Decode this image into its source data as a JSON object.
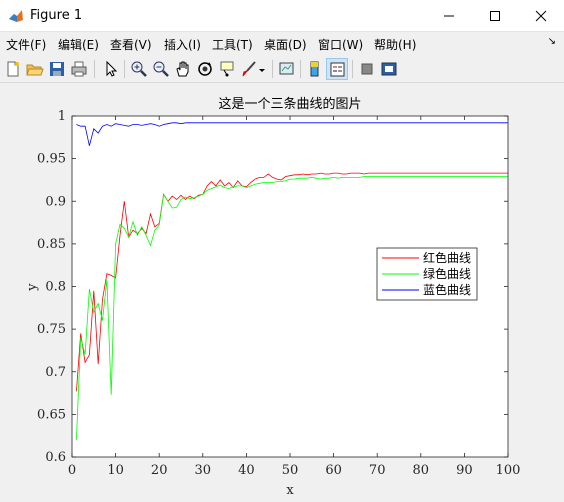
{
  "window": {
    "title": "Figure 1",
    "controls": [
      "minimize",
      "maximize",
      "close"
    ]
  },
  "menu": {
    "items": [
      "文件(F)",
      "编辑(E)",
      "查看(V)",
      "插入(I)",
      "工具(T)",
      "桌面(D)",
      "窗口(W)",
      "帮助(H)"
    ]
  },
  "toolbar": {
    "buttons": [
      "new-figure-icon",
      "open-file-icon",
      "save-icon",
      "print-icon",
      "select-arrow-icon",
      "zoom-in-icon",
      "zoom-out-icon",
      "pan-hand-icon",
      "rotate-3d-icon",
      "data-cursor-icon",
      "brush-icon",
      "link-plot-icon",
      "colorbar-icon",
      "legend-icon",
      "hide-plot-tools-icon",
      "show-plot-tools-icon"
    ]
  },
  "chart_data": {
    "type": "line",
    "title": "这是一个三条曲线的图片",
    "xlabel": "x",
    "ylabel": "y",
    "xlim": [
      0,
      100
    ],
    "ylim": [
      0.6,
      1.0
    ],
    "xticks": [
      0,
      10,
      20,
      30,
      40,
      50,
      60,
      70,
      80,
      90,
      100
    ],
    "yticks": [
      0.6,
      0.65,
      0.7,
      0.75,
      0.8,
      0.85,
      0.9,
      0.95,
      1.0
    ],
    "ytick_labels": [
      "0.6",
      "0.65",
      "0.7",
      "0.75",
      "0.8",
      "0.85",
      "0.9",
      "0.95",
      "1"
    ],
    "grid": false,
    "legend_position": "right",
    "x": [
      1,
      2,
      3,
      4,
      5,
      6,
      7,
      8,
      9,
      10,
      11,
      12,
      13,
      14,
      15,
      16,
      17,
      18,
      19,
      20,
      21,
      22,
      23,
      24,
      25,
      26,
      27,
      28,
      29,
      30,
      31,
      32,
      33,
      34,
      35,
      36,
      37,
      38,
      39,
      40,
      41,
      42,
      43,
      44,
      45,
      46,
      47,
      48,
      49,
      50,
      51,
      52,
      53,
      54,
      55,
      56,
      57,
      58,
      59,
      60,
      61,
      62,
      63,
      64,
      65,
      66,
      67,
      68,
      69,
      70,
      71,
      72,
      73,
      74,
      75,
      76,
      77,
      78,
      79,
      80,
      81,
      82,
      83,
      84,
      85,
      86,
      87,
      88,
      89,
      90,
      91,
      92,
      93,
      94,
      95,
      96,
      97,
      98,
      99,
      100
    ],
    "series": [
      {
        "name": "红色曲线",
        "color": "#ff0000",
        "values": [
          0.677,
          0.745,
          0.711,
          0.72,
          0.795,
          0.709,
          0.785,
          0.815,
          0.813,
          0.81,
          0.86,
          0.9,
          0.858,
          0.866,
          0.862,
          0.868,
          0.862,
          0.885,
          0.87,
          0.874,
          0.908,
          0.9,
          0.906,
          0.902,
          0.907,
          0.902,
          0.906,
          0.903,
          0.907,
          0.908,
          0.918,
          0.923,
          0.918,
          0.925,
          0.918,
          0.922,
          0.916,
          0.924,
          0.918,
          0.917,
          0.922,
          0.926,
          0.928,
          0.928,
          0.932,
          0.928,
          0.926,
          0.925,
          0.929,
          0.93,
          0.931,
          0.931,
          0.932,
          0.931,
          0.932,
          0.932,
          0.933,
          0.932,
          0.932,
          0.933,
          0.933,
          0.932,
          0.932,
          0.933,
          0.933,
          0.933,
          0.932,
          0.933,
          0.933,
          0.933,
          0.933,
          0.933,
          0.933,
          0.933,
          0.933,
          0.933,
          0.933,
          0.933,
          0.933,
          0.933,
          0.933,
          0.933,
          0.933,
          0.933,
          0.933,
          0.933,
          0.933,
          0.933,
          0.933,
          0.933,
          0.933,
          0.933,
          0.933,
          0.933,
          0.933,
          0.933,
          0.933,
          0.933,
          0.933,
          0.933
        ]
      },
      {
        "name": "绿色曲线",
        "color": "#00ff00",
        "values": [
          0.62,
          0.74,
          0.72,
          0.797,
          0.77,
          0.78,
          0.76,
          0.808,
          0.673,
          0.85,
          0.873,
          0.868,
          0.858,
          0.876,
          0.86,
          0.87,
          0.86,
          0.848,
          0.866,
          0.872,
          0.908,
          0.9,
          0.892,
          0.893,
          0.902,
          0.905,
          0.903,
          0.904,
          0.906,
          0.908,
          0.913,
          0.915,
          0.917,
          0.919,
          0.916,
          0.915,
          0.917,
          0.918,
          0.918,
          0.916,
          0.918,
          0.92,
          0.921,
          0.922,
          0.922,
          0.922,
          0.923,
          0.923,
          0.924,
          0.926,
          0.926,
          0.927,
          0.927,
          0.927,
          0.928,
          0.927,
          0.926,
          0.927,
          0.927,
          0.928,
          0.927,
          0.928,
          0.928,
          0.928,
          0.928,
          0.928,
          0.929,
          0.929,
          0.929,
          0.929,
          0.929,
          0.929,
          0.929,
          0.929,
          0.929,
          0.929,
          0.929,
          0.929,
          0.929,
          0.929,
          0.929,
          0.929,
          0.929,
          0.929,
          0.929,
          0.929,
          0.929,
          0.929,
          0.929,
          0.929,
          0.929,
          0.929,
          0.929,
          0.929,
          0.929,
          0.929,
          0.929,
          0.929,
          0.929,
          0.929
        ]
      },
      {
        "name": "蓝色曲线",
        "color": "#0000ff",
        "values": [
          0.99,
          0.988,
          0.988,
          0.965,
          0.985,
          0.98,
          0.988,
          0.99,
          0.988,
          0.991,
          0.99,
          0.989,
          0.988,
          0.99,
          0.99,
          0.989,
          0.99,
          0.991,
          0.99,
          0.988,
          0.99,
          0.991,
          0.992,
          0.992,
          0.991,
          0.992,
          0.992,
          0.992,
          0.992,
          0.992,
          0.992,
          0.992,
          0.992,
          0.992,
          0.992,
          0.992,
          0.992,
          0.992,
          0.992,
          0.992,
          0.992,
          0.992,
          0.992,
          0.992,
          0.992,
          0.992,
          0.992,
          0.992,
          0.992,
          0.992,
          0.992,
          0.992,
          0.992,
          0.992,
          0.992,
          0.992,
          0.992,
          0.992,
          0.992,
          0.992,
          0.992,
          0.992,
          0.992,
          0.992,
          0.992,
          0.992,
          0.992,
          0.992,
          0.992,
          0.992,
          0.992,
          0.992,
          0.992,
          0.992,
          0.992,
          0.992,
          0.992,
          0.992,
          0.992,
          0.992,
          0.992,
          0.992,
          0.992,
          0.992,
          0.992,
          0.992,
          0.992,
          0.992,
          0.992,
          0.992,
          0.992,
          0.992,
          0.992,
          0.992,
          0.992,
          0.992,
          0.992,
          0.992,
          0.992,
          0.992
        ]
      }
    ]
  }
}
